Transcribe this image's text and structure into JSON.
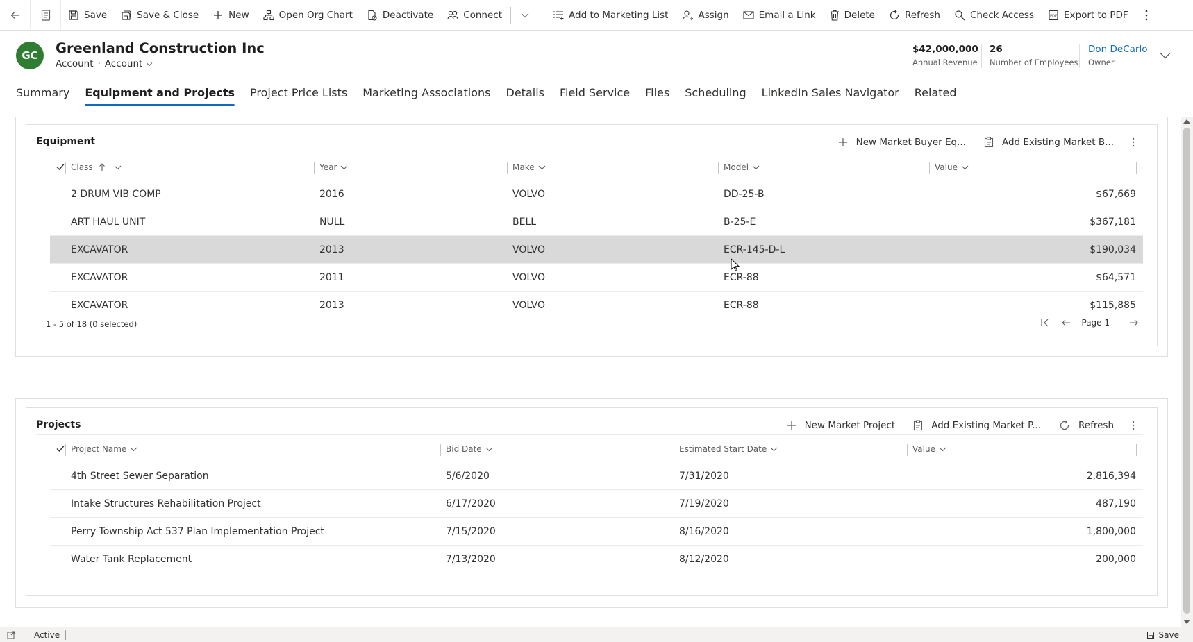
{
  "command_bar": {
    "items": [
      {
        "icon": "save-icon",
        "label": "Save"
      },
      {
        "icon": "save-close-icon",
        "label": "Save & Close"
      },
      {
        "icon": "plus-icon",
        "label": "New"
      },
      {
        "icon": "org-chart-icon",
        "label": "Open Org Chart"
      },
      {
        "icon": "deactivate-icon",
        "label": "Deactivate"
      },
      {
        "icon": "connect-icon",
        "label": "Connect"
      },
      {
        "icon": "marketing-list-icon",
        "label": "Add to Marketing List"
      },
      {
        "icon": "assign-icon",
        "label": "Assign"
      },
      {
        "icon": "email-link-icon",
        "label": "Email a Link"
      },
      {
        "icon": "delete-icon",
        "label": "Delete"
      },
      {
        "icon": "refresh-icon",
        "label": "Refresh"
      },
      {
        "icon": "check-access-icon",
        "label": "Check Access"
      },
      {
        "icon": "pdf-icon",
        "label": "Export to PDF"
      }
    ]
  },
  "record": {
    "initials": "GC",
    "avatar_color": "#2e7d32",
    "title": "Greenland Construction Inc",
    "entity": "Account",
    "form": "Account",
    "fields": [
      {
        "value": "$42,000,000",
        "label": "Annual Revenue"
      },
      {
        "value": "26",
        "label": "Number of Employees"
      },
      {
        "value": "Don DeCarlo",
        "label": "Owner"
      }
    ]
  },
  "tabs": [
    {
      "label": "Summary",
      "active": false
    },
    {
      "label": "Equipment and Projects",
      "active": true
    },
    {
      "label": "Project Price Lists",
      "active": false
    },
    {
      "label": "Marketing Associations",
      "active": false
    },
    {
      "label": "Details",
      "active": false
    },
    {
      "label": "Field Service",
      "active": false
    },
    {
      "label": "Files",
      "active": false
    },
    {
      "label": "Scheduling",
      "active": false
    },
    {
      "label": "LinkedIn Sales Navigator",
      "active": false
    },
    {
      "label": "Related",
      "active": false
    }
  ],
  "equipment": {
    "title": "Equipment",
    "actions": {
      "new": "New Market Buyer Eq...",
      "add_existing": "Add Existing Market B..."
    },
    "columns": [
      "Class",
      "Year",
      "Make",
      "Model",
      "Value"
    ],
    "rows": [
      {
        "class": "2 DRUM VIB COMP",
        "year": "2016",
        "make": "VOLVO",
        "model": "DD-25-B",
        "value": "$67,669",
        "selected": false
      },
      {
        "class": "ART HAUL UNIT",
        "year": "NULL",
        "make": "BELL",
        "model": "B-25-E",
        "value": "$367,181",
        "selected": false
      },
      {
        "class": "EXCAVATOR",
        "year": "2013",
        "make": "VOLVO",
        "model": "ECR-145-D-L",
        "value": "$190,034",
        "selected": true
      },
      {
        "class": "EXCAVATOR",
        "year": "2011",
        "make": "VOLVO",
        "model": "ECR-88",
        "value": "$64,571",
        "selected": false
      },
      {
        "class": "EXCAVATOR",
        "year": "2013",
        "make": "VOLVO",
        "model": "ECR-88",
        "value": "$115,885",
        "selected": false
      }
    ],
    "footer": "1 - 5 of 18 (0 selected)",
    "page": "Page 1"
  },
  "projects": {
    "title": "Projects",
    "actions": {
      "new": "New Market Project",
      "add_existing": "Add Existing Market P...",
      "refresh": "Refresh"
    },
    "columns": [
      "Project Name",
      "Bid Date",
      "Estimated Start Date",
      "Value"
    ],
    "rows": [
      {
        "name": "4th Street Sewer Separation",
        "bid": "5/6/2020",
        "start": "7/31/2020",
        "value": "2,816,394"
      },
      {
        "name": "Intake Structures Rehabilitation Project",
        "bid": "6/17/2020",
        "start": "7/19/2020",
        "value": "487,190"
      },
      {
        "name": "Perry Township Act 537 Plan Implementation Project",
        "bid": "7/15/2020",
        "start": "8/16/2020",
        "value": "1,800,000"
      },
      {
        "name": "Water Tank Replacement",
        "bid": "7/13/2020",
        "start": "8/12/2020",
        "value": "200,000"
      }
    ]
  },
  "status_bar": {
    "status": "Active",
    "save": "Save"
  },
  "colors": {
    "accent": "#0f6cbd",
    "selected_row": "#d9d9d9"
  }
}
